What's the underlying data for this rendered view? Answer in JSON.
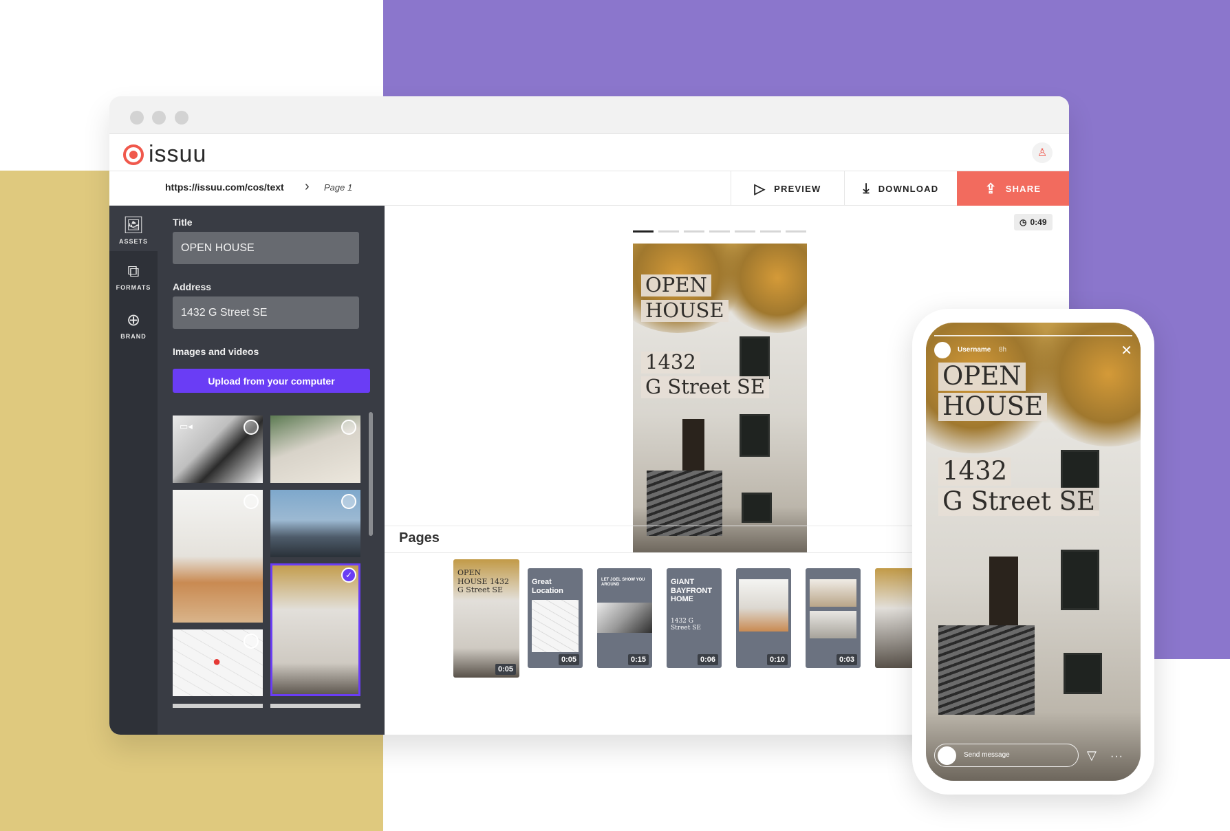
{
  "app": {
    "logo_text": "issuu",
    "url": "https://issuu.com/cos/text",
    "breadcrumb_page": "Page 1"
  },
  "actions": {
    "preview": "PREVIEW",
    "download": "DOWNLOAD",
    "share": "SHARE"
  },
  "rail": [
    {
      "label": "ASSETS",
      "icon": "image-icon"
    },
    {
      "label": "FORMATS",
      "icon": "formats-icon"
    },
    {
      "label": "BRAND",
      "icon": "globe-icon"
    }
  ],
  "panel": {
    "title_label": "Title",
    "title_value": "OPEN HOUSE",
    "address_label": "Address",
    "address_value": "1432 G Street SE",
    "media_label": "Images and videos",
    "upload_label": "Upload from your computer"
  },
  "story": {
    "timer": "0:49",
    "line1": "OPEN",
    "line2": "HOUSE",
    "line3": "1432",
    "line4": "G Street SE"
  },
  "pages": {
    "title": "Pages",
    "cards": [
      {
        "duration": "0:05",
        "text": "OPEN HOUSE 1432 G Street SE"
      },
      {
        "duration": "0:05",
        "text": "Great Location"
      },
      {
        "duration": "0:15",
        "text": "LET JOEL SHOW YOU AROUND"
      },
      {
        "duration": "0:06",
        "text": "GIANT BAYFRONT HOME",
        "sub": "1432 G Street SE"
      },
      {
        "duration": "0:10",
        "text": ""
      },
      {
        "duration": "0:03",
        "text": ""
      }
    ]
  },
  "phone": {
    "username": "Username",
    "time": "8h",
    "message_placeholder": "Send message"
  },
  "colors": {
    "purple_bg": "#8b76cc",
    "yellow_bg": "#dfc97e",
    "share": "#f26b5e",
    "upload": "#6a3df5",
    "brand": "#f0584c"
  }
}
